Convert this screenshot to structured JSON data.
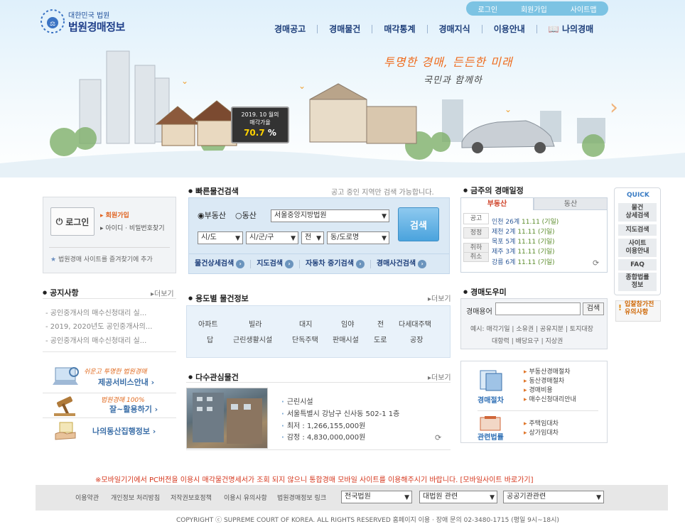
{
  "logo": {
    "sub": "대한민국 법원",
    "main": "법원경매정보"
  },
  "util": [
    "로그인",
    "회원가입",
    "사이트맵"
  ],
  "gnb": [
    "경매공고",
    "경매물건",
    "매각통계",
    "경매지식",
    "이용안내",
    "나의경매"
  ],
  "hero": {
    "slogan1": "투명한 경매, 든든한 미래",
    "slogan2": "국민과 함께하",
    "board_title": "2019. 10 월의",
    "board_sub": "매각가율",
    "board_value": "70.7",
    "board_unit": "%"
  },
  "login": {
    "button": "로그인",
    "join": "회원가입",
    "find": "아이디 · 비밀번호찾기",
    "favorite": "법원경매 사이트를 즐겨찾기에 추가"
  },
  "notice": {
    "title": "공지사항",
    "more": "더보기",
    "items": [
      "공인중개사의 매수신청대리 실...",
      "2019, 2020년도 공인중개사의...",
      "공인중개사의 매수신청대리 실..."
    ]
  },
  "banners": [
    {
      "line1": "쉬운고 투명한 법원경매",
      "line2": "제공서비스안내"
    },
    {
      "line1": "법원경매 100%",
      "line2": "잘~활용하기"
    },
    {
      "line1": "",
      "line2": "나의동산집행정보"
    }
  ],
  "quick_search": {
    "title": "빠른물건검색",
    "note": "공고 중인 지역만 검색 가능합니다.",
    "radio1": "부동산",
    "radio2": "동산",
    "court": "서울중앙지방법원",
    "sido": "시/도",
    "sigungu": "시/군/구",
    "jeon": "전",
    "dong": "동/도로명",
    "button": "검색",
    "links": [
      "물건상세검색",
      "지도검색",
      "자동차 중기검색",
      "경매사건검색"
    ]
  },
  "usage": {
    "title": "용도별 물건정보",
    "more": "더보기",
    "row1": [
      "아파트",
      "빌라",
      "대지",
      "임야",
      "전",
      "다세대주택"
    ],
    "row2": [
      "답",
      "근린생활시설",
      "단독주택",
      "판매시설",
      "도로",
      "공장"
    ]
  },
  "popular": {
    "title": "다수관심물건",
    "more": "더보기",
    "items": [
      "근린시설",
      "서울특별시 강남구 신사동 502-1 1층",
      "최저 : 1,266,155,000원",
      "감정 : 4,830,000,000원"
    ]
  },
  "schedule": {
    "title": "금주의 경매일정",
    "tab1": "부동산",
    "tab2": "동산",
    "side": [
      "공고",
      "정정",
      "취하",
      "취소"
    ],
    "items": [
      {
        "court": "인천 26계",
        "date": "11.11 (기일)"
      },
      {
        "court": "제천 2계",
        "date": "11.11 (기일)"
      },
      {
        "court": "목포 5계",
        "date": "11.11 (기일)"
      },
      {
        "court": "제주 3계",
        "date": "11.11 (기일)"
      },
      {
        "court": "강릉 6계",
        "date": "11.11 (기일)"
      }
    ]
  },
  "helper": {
    "title": "경매도우미",
    "term_label": "경매용어",
    "button": "검색",
    "examples1": "예시: 매각기일 | 소유권 | 공유지분 | 토지대장",
    "examples2": "대항력 | 배당요구 | 지상권"
  },
  "procedure": {
    "title1": "경매절차",
    "title2": "관련법률",
    "items1": [
      "부동산경매절차",
      "동산경매절차",
      "경매비용",
      "매수신청대리안내"
    ],
    "items2": [
      "주택임대차",
      "상가임대차"
    ]
  },
  "quick": {
    "title": "QUICK",
    "items": [
      "물건\n상세검색",
      "지도검색",
      "사이트\n이용안내",
      "FAQ",
      "종합법률\n정보"
    ],
    "warn": "입찰참가전 유의사항"
  },
  "footer": {
    "note": "※모바일기기에서 PC버전을 이용시 매각물건명세서가 조회 되지 않으니 통합경매 모바일 사이트를 이용해주시기 바랍니다. [모바일사이트 바로가기]",
    "links": [
      "이용약관",
      "개인정보 처리방침",
      "저작권보호정책",
      "이용시 유의사항",
      "법원경매정보 링크"
    ],
    "select1": "전국법원",
    "select2": "대법원 관련",
    "select3": "공공기관관련",
    "copyright": "COPYRIGHT ⓒ  SUPREME COURT OF KOREA. ALL RIGHTS RESERVED  홈페이지 이용 · 장애 문의 02-3480-1715 (평일 9시~18시)"
  }
}
